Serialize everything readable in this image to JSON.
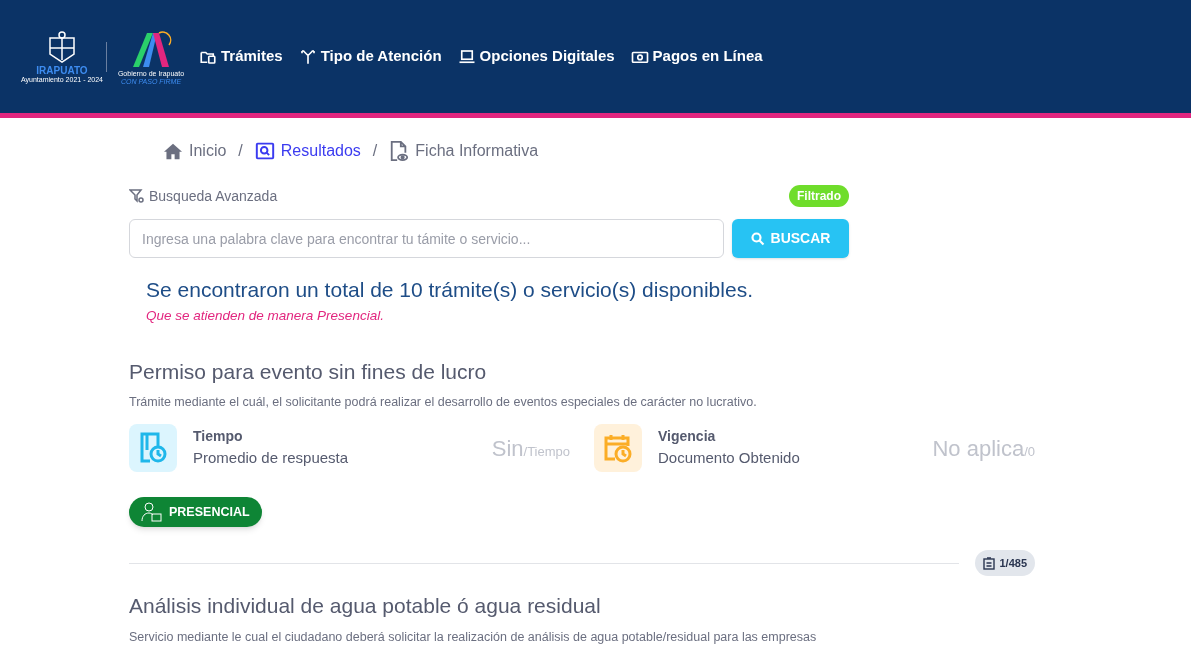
{
  "header": {
    "logo_city": {
      "name": "IRAPUATO",
      "subtitle": "Ayuntamiento 2021 - 2024"
    },
    "logo_gov": {
      "line1": "Gobierno de Irapuato",
      "line2": "CON PASO FIRME"
    },
    "nav": [
      {
        "label": "Trámites",
        "kind": "folder"
      },
      {
        "label": "Tipo de Atención",
        "kind": "split"
      },
      {
        "label": "Opciones Digitales",
        "kind": "laptop"
      },
      {
        "label": "Pagos en Línea",
        "kind": "cash"
      }
    ]
  },
  "breadcrumb_separator": "/",
  "breadcrumb": [
    {
      "label": "Inicio",
      "kind": "home",
      "selected": false
    },
    {
      "label": "Resultados",
      "kind": "search",
      "selected": true
    },
    {
      "label": "Ficha Informativa",
      "kind": "file",
      "selected": false
    }
  ],
  "advanced_search": {
    "label": "Busqueda Avanzada",
    "badge": "Filtrado"
  },
  "search": {
    "placeholder": "Ingresa una palabra clave para encontrar tu támite o servicio...",
    "button": "BUSCAR"
  },
  "results": {
    "summary": "Se encontraron un total de 10 trámite(s) o servicio(s) disponibles.",
    "note": "Que se atienden de manera Presencial."
  },
  "items": [
    {
      "title": "Permiso para evento sin fines de lucro",
      "description": "Trámite mediante el cuál, el solicitante podrá realizar el desarrollo de eventos especiales de carácter no lucrativo.",
      "stats": [
        {
          "kind": "time",
          "title": "Tiempo",
          "subtitle": "Promedio de respuesta",
          "value": "Sin",
          "unit": "/Tiempo"
        },
        {
          "kind": "calendar",
          "title": "Vigencia",
          "subtitle": "Documento Obtenido",
          "value": "No aplica",
          "unit": "/0"
        }
      ],
      "tag": "PRESENCIAL",
      "counter": "1/485"
    },
    {
      "title": "Análisis individual de agua potable ó agua residual",
      "description": "Servicio mediante le cual el ciudadano deberá solicitar la realización de análisis de agua potable/residual para las empresas"
    }
  ]
}
